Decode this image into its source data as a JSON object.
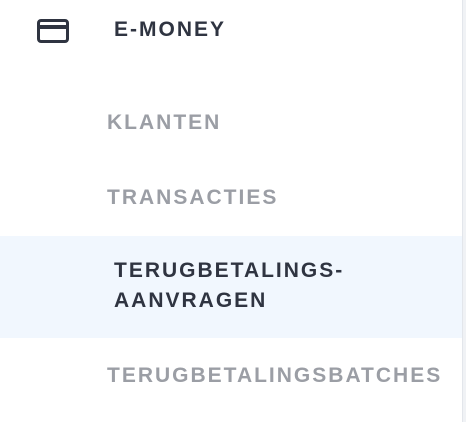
{
  "sidebar": {
    "section": {
      "icon": "credit-card-icon",
      "title": "E-MONEY"
    },
    "items": [
      {
        "label": "KLANTEN",
        "active": false
      },
      {
        "label": "TRANSACTIES",
        "active": false
      },
      {
        "label": "TERUGBETALINGS-\nAANVRAGEN",
        "active": true
      },
      {
        "label": "TERUGBETALINGSBATCHES",
        "active": false
      }
    ]
  },
  "colors": {
    "active_background": "#f1f7fe",
    "active_text": "#2f3441",
    "inactive_text": "#9b9ea5",
    "section_title": "#2f3441"
  }
}
